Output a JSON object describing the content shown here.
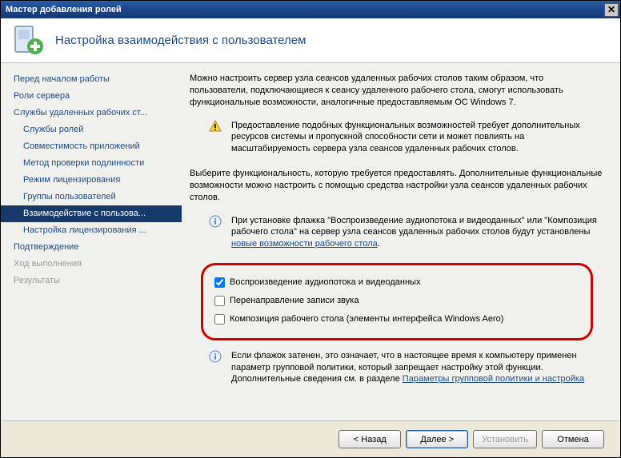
{
  "window": {
    "title": "Мастер добавления ролей"
  },
  "header": {
    "title": "Настройка взаимодействия с пользователем"
  },
  "sidebar": {
    "items": [
      {
        "label": "Перед началом работы",
        "sub": false,
        "selected": false,
        "disabled": false
      },
      {
        "label": "Роли сервера",
        "sub": false,
        "selected": false,
        "disabled": false
      },
      {
        "label": "Службы удаленных рабочих ст...",
        "sub": false,
        "selected": false,
        "disabled": false
      },
      {
        "label": "Службы ролей",
        "sub": true,
        "selected": false,
        "disabled": false
      },
      {
        "label": "Совместимость приложений",
        "sub": true,
        "selected": false,
        "disabled": false
      },
      {
        "label": "Метод проверки подлинности",
        "sub": true,
        "selected": false,
        "disabled": false
      },
      {
        "label": "Режим лицензирования",
        "sub": true,
        "selected": false,
        "disabled": false
      },
      {
        "label": "Группы пользователей",
        "sub": true,
        "selected": false,
        "disabled": false
      },
      {
        "label": "Взаимодействие с пользова...",
        "sub": true,
        "selected": true,
        "disabled": false
      },
      {
        "label": "Настройка лицензирования ...",
        "sub": true,
        "selected": false,
        "disabled": false
      },
      {
        "label": "Подтверждение",
        "sub": false,
        "selected": false,
        "disabled": false
      },
      {
        "label": "Ход выполнения",
        "sub": false,
        "selected": false,
        "disabled": true
      },
      {
        "label": "Результаты",
        "sub": false,
        "selected": false,
        "disabled": true
      }
    ]
  },
  "content": {
    "para1": "Можно настроить сервер узла сеансов удаленных рабочих столов таким образом, что пользователи, подключающиеся к сеансу удаленного рабочего стола, смогут использовать функциональные возможности, аналогичные предоставляемым ОС Windows 7.",
    "warning": "Предоставление подобных функциональных возможностей требует дополнительных ресурсов системы и пропускной способности сети и может повлиять на масштабируемость сервера узла сеансов удаленных рабочих столов.",
    "para2": "Выберите функциональность, которую требуется предоставлять. Дополнительные функциональные возможности можно настроить с помощью средства настройки узла сеансов удаленных рабочих столов.",
    "info1_prefix": "При установке флажка \"Воспроизведение аудиопотока и видеоданных\" или \"Композиция рабочего стола\" на сервер узла сеансов удаленных рабочих столов будут установлены ",
    "info1_link": "новые возможности рабочего стола",
    "info1_suffix": ".",
    "checkboxes": [
      {
        "label": "Воспроизведение аудиопотока и видеоданных",
        "checked": true
      },
      {
        "label": "Перенаправление записи звука",
        "checked": false
      },
      {
        "label": "Композиция рабочего стола (элементы интерфейса Windows Aero)",
        "checked": false
      }
    ],
    "info2_prefix": "Если флажок затенен, это означает, что в настоящее время к компьютеру применен параметр групповой политики, который запрещает настройку этой функции. Дополнительные сведения см. в разделе ",
    "info2_link": "Параметры групповой политики и настройка"
  },
  "footer": {
    "back": "< Назад",
    "next": "Далее >",
    "install": "Установить",
    "cancel": "Отмена"
  }
}
